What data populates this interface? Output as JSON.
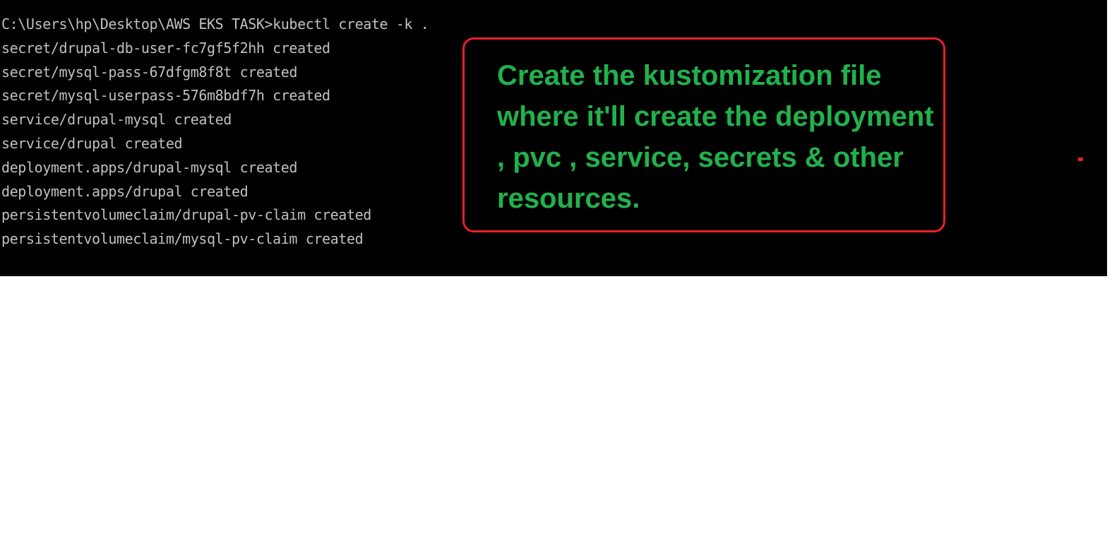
{
  "terminal": {
    "lines": [
      "C:\\Users\\hp\\Desktop\\AWS EKS TASK>kubectl create -k .",
      "secret/drupal-db-user-fc7gf5f2hh created",
      "secret/mysql-pass-67dfgm8f8t created",
      "secret/mysql-userpass-576m8bdf7h created",
      "service/drupal-mysql created",
      "service/drupal created",
      "deployment.apps/drupal-mysql created",
      "deployment.apps/drupal created",
      "persistentvolumeclaim/drupal-pv-claim created",
      "persistentvolumeclaim/mysql-pv-claim created"
    ]
  },
  "callout": {
    "text": "Create the kustomization file where it'll create the deployment , pvc , service, secrets & other resources."
  },
  "colors": {
    "terminal_bg": "#000000",
    "terminal_text": "#c0c0c0",
    "callout_border": "#e8202a",
    "callout_text": "#22b14c"
  }
}
